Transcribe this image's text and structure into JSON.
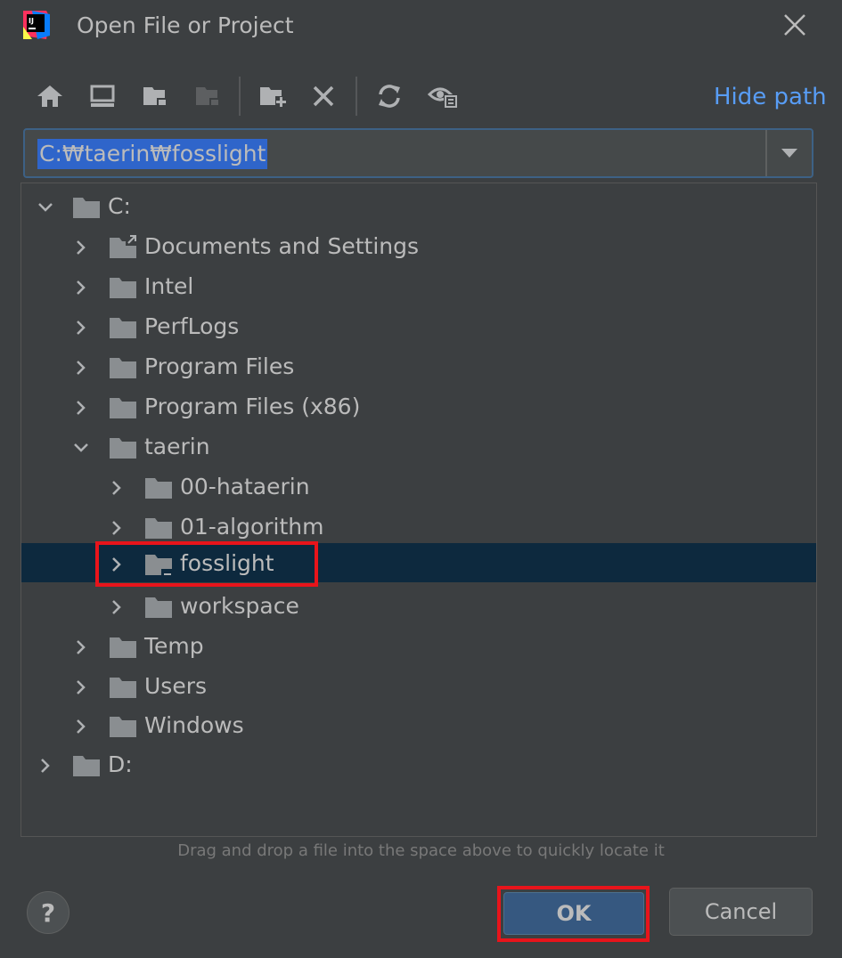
{
  "window": {
    "title": "Open File or Project"
  },
  "toolbar": {
    "hide_path_label": "Hide path"
  },
  "path": {
    "value": "C:₩taerin₩fosslight"
  },
  "tree": {
    "c_drive": "C:",
    "documents_and_settings": "Documents and Settings",
    "intel": "Intel",
    "perflogs": "PerfLogs",
    "program_files": "Program Files",
    "program_files_x86": "Program Files (x86)",
    "taerin": "taerin",
    "hataerin": "00-hataerin",
    "algorithm": "01-algorithm",
    "fosslight": "fosslight",
    "workspace": "workspace",
    "temp": "Temp",
    "users": "Users",
    "windows": "Windows",
    "d_drive": "D:"
  },
  "hint": "Drag and drop a file into the space above to quickly locate it",
  "buttons": {
    "help": "?",
    "ok": "OK",
    "cancel": "Cancel"
  },
  "colors": {
    "accent": "#589df6",
    "selection": "#0d293e",
    "highlight": "#e8141b",
    "ok_bg": "#365880"
  }
}
